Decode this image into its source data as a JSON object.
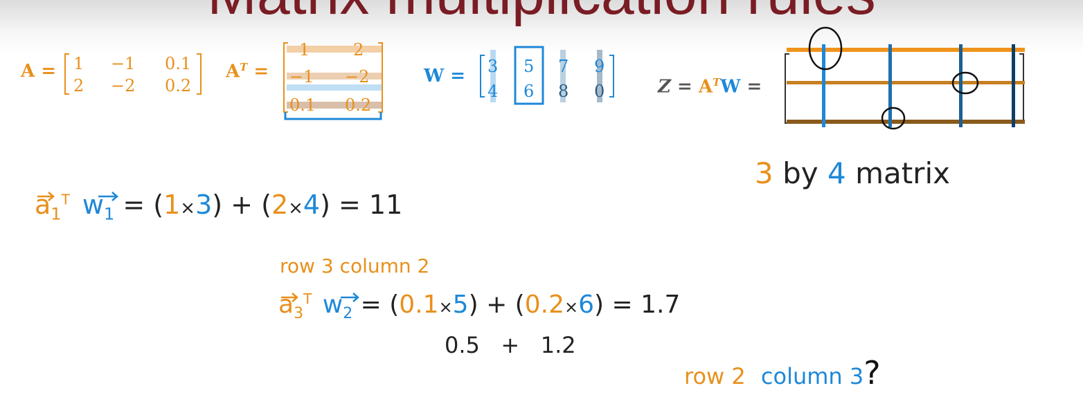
{
  "slide": {
    "title": "Matrix multiplication rules"
  },
  "matrix_a": {
    "label": "A =",
    "rows": [
      [
        "1",
        "−1",
        "0.1"
      ],
      [
        "2",
        "−2",
        "0.2"
      ]
    ]
  },
  "matrix_at": {
    "label": "A",
    "sup": "T",
    "eq": "=",
    "rows": [
      [
        "1",
        "2"
      ],
      [
        "−1",
        "−2"
      ],
      [
        "0.1",
        "0.2"
      ]
    ]
  },
  "matrix_w": {
    "label": "W =",
    "rows": [
      [
        "3",
        "5",
        "7",
        "9"
      ],
      [
        "4",
        "6",
        "8",
        "0"
      ]
    ]
  },
  "matrix_z": {
    "z": "Z",
    "eq1": " = ",
    "a": "A",
    "sup": "T",
    "w": "W",
    "eq2": " ="
  },
  "notes": {
    "size_three": "3",
    "size_by": "by",
    "size_four": "4",
    "size_matrix": "matrix",
    "eq1_a": "a",
    "eq1_a_sub": "1",
    "eq1_t": "T",
    "eq1_w": "w",
    "eq1_w_sub": "1",
    "eq1_open": "= (",
    "eq1_n1": "1",
    "eq1_x1": "×",
    "eq1_n2": "3",
    "eq1_mid": ") + (",
    "eq1_n3": "2",
    "eq1_x2": "×",
    "eq1_n4": "4",
    "eq1_close": ") = 11",
    "row3col2": "row 3 column 2",
    "eq2_a": "a",
    "eq2_a_sub": "3",
    "eq2_t": "T",
    "eq2_w": "w",
    "eq2_w_sub": "2",
    "eq2_open": "= (",
    "eq2_n1": "0.1",
    "eq2_x1": "×",
    "eq2_n2": "5",
    "eq2_mid": ") + (",
    "eq2_n3": "0.2",
    "eq2_x2": "×",
    "eq2_n4": "6",
    "eq2_close": ") = 1.7",
    "partial_sum": "0.5   +   1.2",
    "q_row": "row 2",
    "q_col": "column 3",
    "q_mark": "?"
  },
  "colors": {
    "orange": "#e8901c",
    "blue": "#1e88d8",
    "dark_blue": "#0d4f7a",
    "title_red": "#7a1c24",
    "brown": "#a0661f"
  }
}
